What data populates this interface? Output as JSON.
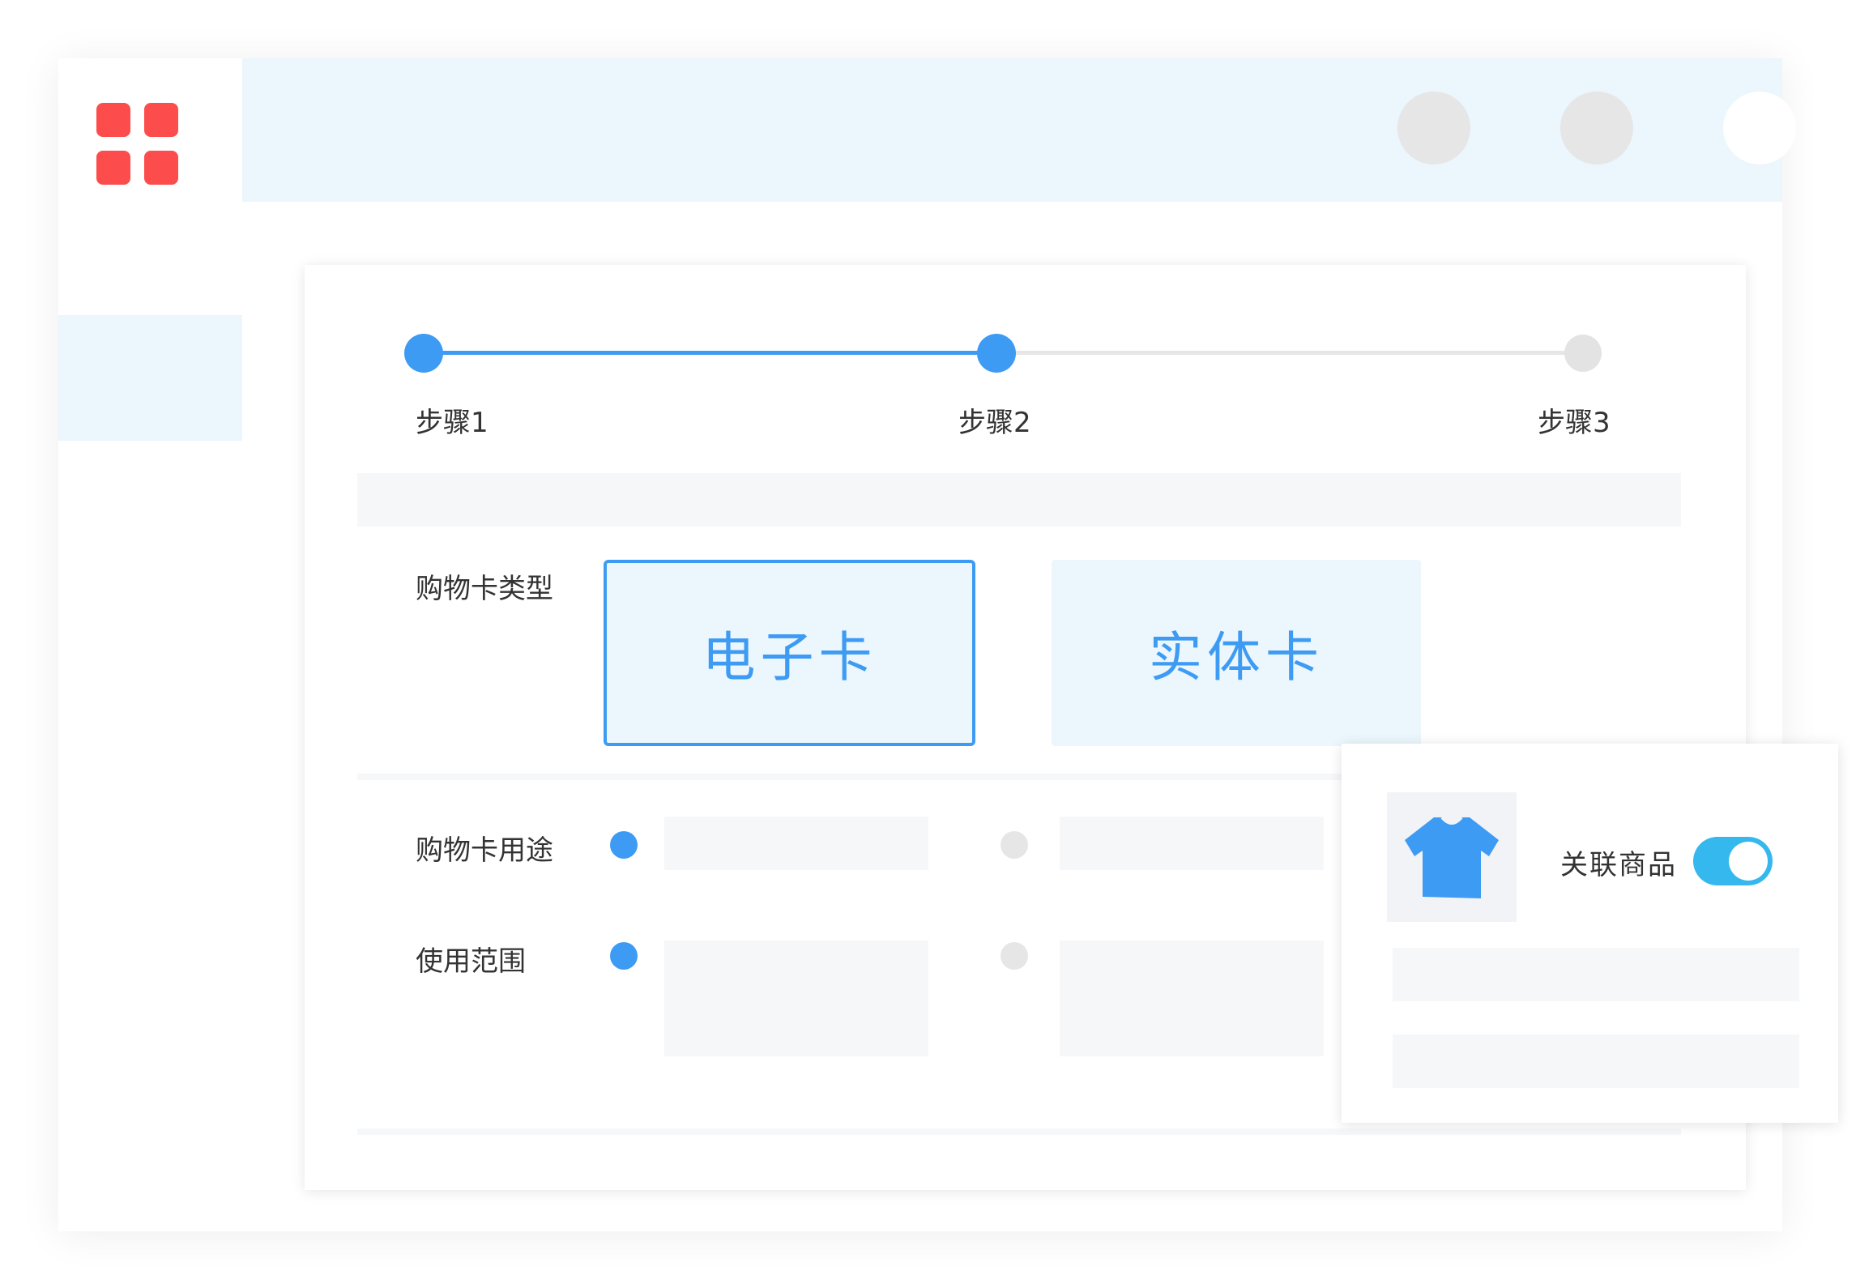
{
  "steps": [
    {
      "label": "步骤1",
      "state": "done"
    },
    {
      "label": "步骤2",
      "state": "current"
    },
    {
      "label": "步骤3",
      "state": "todo"
    }
  ],
  "form": {
    "card_type_label": "购物卡类型",
    "card_type_options": [
      "电子卡",
      "实体卡"
    ],
    "card_type_selected": "电子卡",
    "usage_label": "购物卡用途",
    "scope_label": "使用范围"
  },
  "popover": {
    "product_icon": "t-shirt-icon",
    "link_label": "关联商品",
    "link_toggle_on": true
  },
  "colors": {
    "accent": "#3e9bf3",
    "logo": "#fd4c4c",
    "toggle": "#35b8ee",
    "header_bg": "#ebf6fd"
  }
}
